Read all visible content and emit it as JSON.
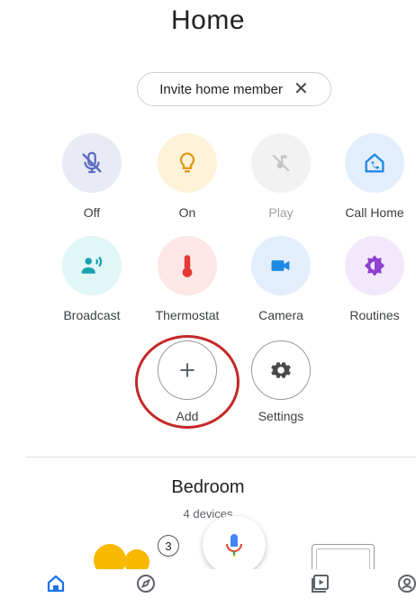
{
  "header": {
    "title": "Home"
  },
  "invite_chip": {
    "label": "Invite home member",
    "close": "✕"
  },
  "actions": [
    {
      "label": "Off",
      "icon": "mic-off-icon",
      "bg": "#e8eaf6",
      "color": "#5c6bc0"
    },
    {
      "label": "On",
      "icon": "lightbulb-icon",
      "bg": "#fef3d9",
      "color": "#e09a18"
    },
    {
      "label": "Play",
      "icon": "music-off-icon",
      "bg": "#f2f2f2",
      "color": "#bdbdbd"
    },
    {
      "label": "Call Home",
      "icon": "call-home-icon",
      "bg": "#e3eefd",
      "color": "#1e88e5"
    },
    {
      "label": "Broadcast",
      "icon": "broadcast-icon",
      "bg": "#e0f6f7",
      "color": "#1aa1b0"
    },
    {
      "label": "Thermostat",
      "icon": "thermometer-icon",
      "bg": "#fde7e7",
      "color": "#e53935"
    },
    {
      "label": "Camera",
      "icon": "video-camera-icon",
      "bg": "#e3eefd",
      "color": "#1e88e5"
    },
    {
      "label": "Routines",
      "icon": "routines-icon",
      "bg": "#f2e8fb",
      "color": "#8e3fd0"
    },
    {
      "label": "Add",
      "icon": "plus-icon"
    },
    {
      "label": "Settings",
      "icon": "gear-icon"
    }
  ],
  "room": {
    "name": "Bedroom",
    "devices": "4 devices",
    "badge_count": "3"
  },
  "nav": [
    "home-icon",
    "discover-icon",
    "media-icon",
    "account-icon"
  ],
  "colors": {
    "accent_blue": "#1a73e8",
    "highlight_red": "#c62828"
  }
}
